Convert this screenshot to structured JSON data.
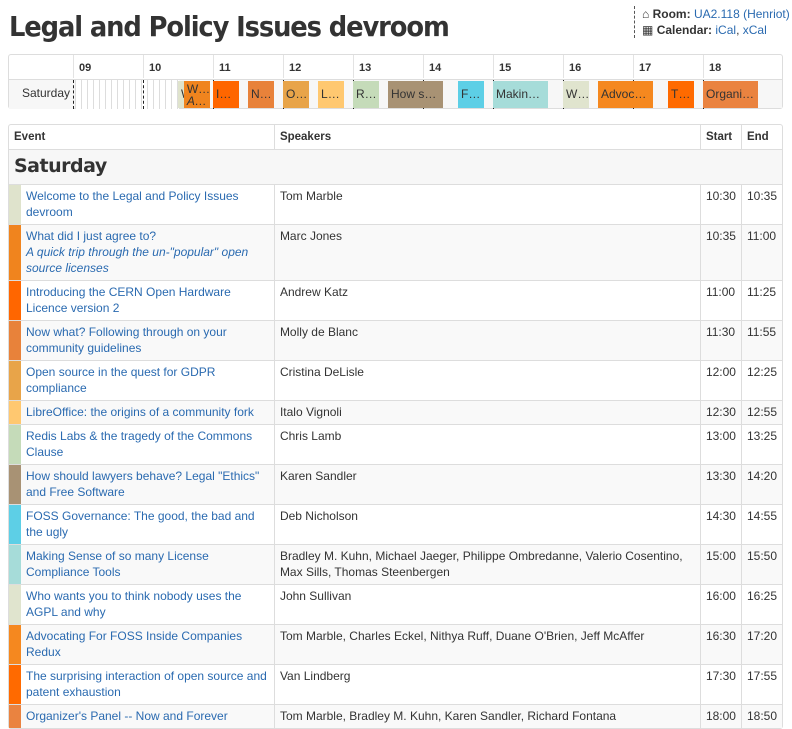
{
  "title": "Legal and Policy Issues devroom",
  "room": {
    "label": "Room:",
    "value": "UA2.118 (Henriot)",
    "icon": "home-icon"
  },
  "calendar": {
    "label": "Calendar:",
    "links": [
      "iCal",
      "xCal"
    ],
    "icon": "calendar-icon"
  },
  "timeline": {
    "day": "Saturday",
    "hours": [
      "09",
      "10",
      "11",
      "12",
      "13",
      "14",
      "15",
      "16",
      "17",
      "18"
    ]
  },
  "table": {
    "headers": [
      "Event",
      "Speakers",
      "Start",
      "End"
    ],
    "day": "Saturday"
  },
  "events": [
    {
      "title": "Welcome to the Legal and Policy Issues devroom",
      "speakers": "Tom Marble",
      "start": "10:30",
      "end": "10:35",
      "color": "#dfe3cc"
    },
    {
      "title": "What did I just agree to?",
      "subtitle": "A quick trip through the un-\"popular\" open source licenses",
      "speakers": "Marc Jones",
      "start": "10:35",
      "end": "11:00",
      "color": "#f0841e"
    },
    {
      "title": "Introducing the CERN Open Hardware Licence version 2",
      "speakers": "Andrew Katz",
      "start": "11:00",
      "end": "11:25",
      "color": "#ff6600"
    },
    {
      "title": "Now what? Following through on your community guidelines",
      "speakers": "Molly de Blanc",
      "start": "11:30",
      "end": "11:55",
      "color": "#e8823a"
    },
    {
      "title": "Open source in the quest for GDPR compliance",
      "speakers": "Cristina DeLisle",
      "start": "12:00",
      "end": "12:25",
      "color": "#e8a449"
    },
    {
      "title": "LibreOffice: the origins of a community fork",
      "speakers": "Italo Vignoli",
      "start": "12:30",
      "end": "12:55",
      "color": "#ffc870"
    },
    {
      "title": "Redis Labs & the tragedy of the Commons Clause",
      "speakers": "Chris Lamb",
      "start": "13:00",
      "end": "13:25",
      "color": "#c5dbb9"
    },
    {
      "title": "How should lawyers behave? Legal \"Ethics\" and Free Software",
      "speakers": "Karen Sandler",
      "start": "13:30",
      "end": "14:20",
      "color": "#a89274"
    },
    {
      "title": "FOSS Governance: The good, the bad and the ugly",
      "speakers": "Deb Nicholson",
      "start": "14:30",
      "end": "14:55",
      "color": "#5dcfe6"
    },
    {
      "title": "Making Sense of so many License Compliance Tools",
      "speakers": "Bradley M. Kuhn, Michael Jaeger, Philippe Ombredanne, Valerio Cosentino, Max Sills, Thomas Steenbergen",
      "start": "15:00",
      "end": "15:50",
      "color": "#a6dcd9"
    },
    {
      "title": "Who wants you to think nobody uses the AGPL and why",
      "speakers": "John Sullivan",
      "start": "16:00",
      "end": "16:25",
      "color": "#e0e4ce"
    },
    {
      "title": "Advocating For FOSS Inside Companies Redux",
      "speakers": "Tom Marble, Charles Eckel, Nithya Ruff, Duane O'Brien, Jeff McAffer",
      "start": "16:30",
      "end": "17:20",
      "color": "#f5881f"
    },
    {
      "title": "The surprising interaction of open source and patent exhaustion",
      "speakers": "Van Lindberg",
      "start": "17:30",
      "end": "17:55",
      "color": "#ff6a00"
    },
    {
      "title": "Organizer's Panel -- Now and Forever",
      "speakers": "Tom Marble, Bradley M. Kuhn, Karen Sandler, Richard Fontana",
      "start": "18:00",
      "end": "18:50",
      "color": "#ea8340"
    }
  ]
}
